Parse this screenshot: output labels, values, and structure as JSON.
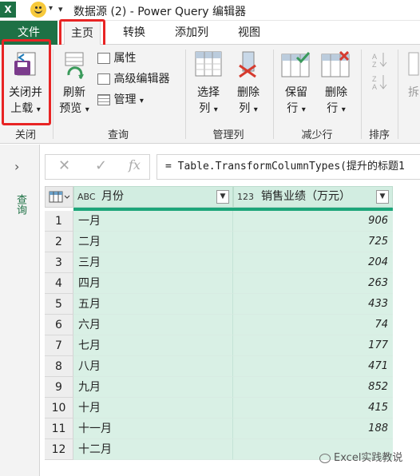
{
  "titlebar": {
    "app_logo": "X",
    "title": "数据源 (2) - Power Query 编辑器"
  },
  "tabs": {
    "file": "文件",
    "home": "主页",
    "transform": "转换",
    "add_column": "添加列",
    "view": "视图"
  },
  "ribbon": {
    "close_load": {
      "line1": "关闭并",
      "line2": "上载",
      "arrow": "▾"
    },
    "refresh": {
      "line1": "刷新",
      "line2": "预览",
      "arrow": "▾"
    },
    "properties": "属性",
    "advanced_editor": "高级编辑器",
    "manage": "管理",
    "manage_arrow": "▾",
    "choose_columns": {
      "line1": "选择",
      "line2": "列",
      "arrow": "▾"
    },
    "remove_columns": {
      "line1": "删除",
      "line2": "列",
      "arrow": "▾"
    },
    "keep_rows": {
      "line1": "保留",
      "line2": "行",
      "arrow": "▾"
    },
    "remove_rows": {
      "line1": "删除",
      "line2": "行",
      "arrow": "▾"
    },
    "split": "拆",
    "groups": {
      "close": "关闭",
      "query": "查询",
      "manage_columns": "管理列",
      "reduce_rows": "减少行",
      "sort": "排序"
    }
  },
  "side_panel": {
    "arrow": "›",
    "label": "查询"
  },
  "formula_bar": {
    "cancel": "✕",
    "confirm": "✓",
    "fx": "fx",
    "formula": "= Table.TransformColumnTypes(提升的标题1"
  },
  "table": {
    "columns": [
      {
        "type": "ABC",
        "name": "月份"
      },
      {
        "type": "123",
        "name": "销售业绩（万元）"
      }
    ],
    "rows": [
      {
        "idx": "1",
        "month": "一月",
        "sales": "906"
      },
      {
        "idx": "2",
        "month": "二月",
        "sales": "725"
      },
      {
        "idx": "3",
        "month": "三月",
        "sales": "204"
      },
      {
        "idx": "4",
        "month": "四月",
        "sales": "263"
      },
      {
        "idx": "5",
        "month": "五月",
        "sales": "433"
      },
      {
        "idx": "6",
        "month": "六月",
        "sales": "74"
      },
      {
        "idx": "7",
        "month": "七月",
        "sales": "177"
      },
      {
        "idx": "8",
        "month": "八月",
        "sales": "471"
      },
      {
        "idx": "9",
        "month": "九月",
        "sales": "852"
      },
      {
        "idx": "10",
        "month": "十月",
        "sales": "415"
      },
      {
        "idx": "11",
        "month": "十一月",
        "sales": "188"
      },
      {
        "idx": "12",
        "month": "十二月",
        "sales": ""
      }
    ]
  },
  "watermark": "Excel实践教说",
  "colors": {
    "excel_green": "#1e7145",
    "highlight_red": "#e82424",
    "cell_green": "#d9f0e5"
  }
}
